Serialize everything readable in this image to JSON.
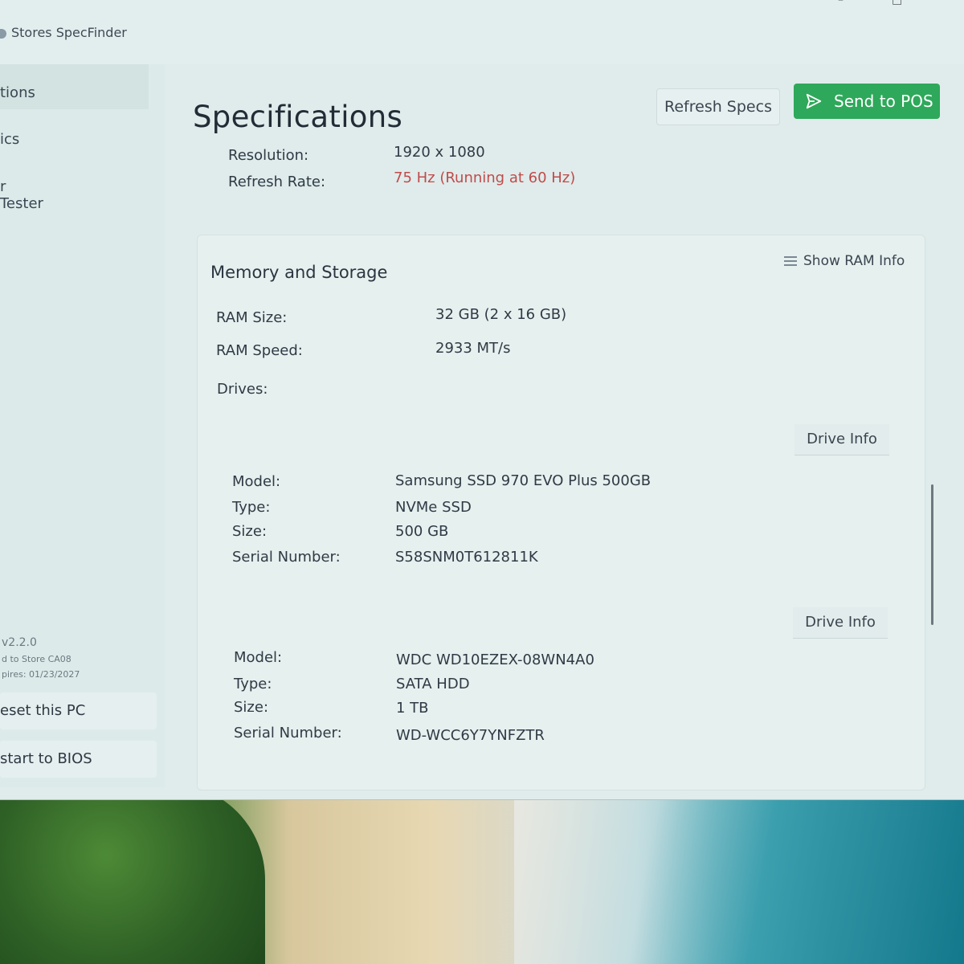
{
  "window": {
    "title": "Stores SpecFinder"
  },
  "sidebar": {
    "items": [
      {
        "label": "tions",
        "active": true
      },
      {
        "label": "ics",
        "active": false
      },
      {
        "label": "r Tester",
        "active": false
      }
    ],
    "version": "v2.2.0",
    "assigned": "d to Store CA08",
    "expires": "pires: 01/23/2027",
    "reset_label": "eset this PC",
    "bios_label": "start to BIOS"
  },
  "header": {
    "title": "Specifications",
    "refresh_label": "Refresh Specs",
    "send_label": "Send to POS"
  },
  "display": {
    "resolution_label": "Resolution:",
    "resolution_value": "1920 x 1080",
    "refresh_label": "Refresh Rate:",
    "refresh_value": "75 Hz (Running at 60 Hz)"
  },
  "memory": {
    "title": "Memory and Storage",
    "show_ram_label": "Show RAM Info",
    "ram_size_label": "RAM Size:",
    "ram_size_value": "32 GB (2 x 16 GB)",
    "ram_speed_label": "RAM Speed:",
    "ram_speed_value": "2933 MT/s",
    "drives_label": "Drives:",
    "drive_info_label": "Drive Info",
    "drives": [
      {
        "model_label": "Model:",
        "model": "Samsung SSD 970 EVO Plus 500GB",
        "type_label": "Type:",
        "type": "NVMe SSD",
        "size_label": "Size:",
        "size": "500 GB",
        "serial_label": "Serial Number:",
        "serial": "S58SNM0T612811K"
      },
      {
        "model_label": "Model:",
        "model": "WDC WD10EZEX-08WN4A0",
        "type_label": "Type:",
        "type": "SATA HDD",
        "size_label": "Size:",
        "size": "1 TB",
        "serial_label": "Serial Number:",
        "serial": "WD-WCC6Y7YNFZTR"
      }
    ]
  },
  "colors": {
    "accent": "#2ea85a",
    "warning": "#c04b4b"
  }
}
